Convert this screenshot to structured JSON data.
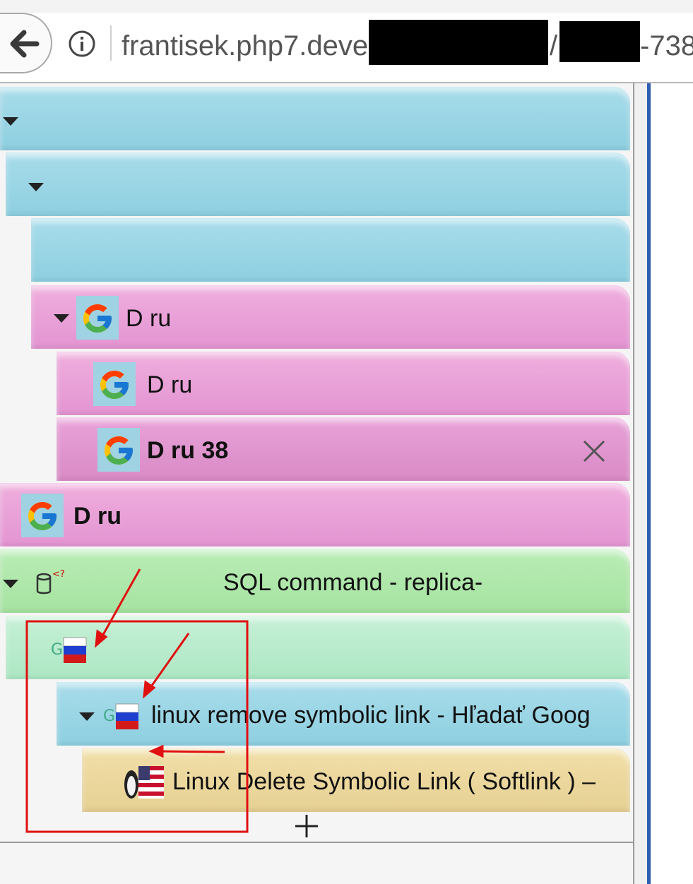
{
  "browser": {
    "url_visible_start": "frantisek.php7.deve",
    "url_visible_mid": "/",
    "url_visible_end": "-738"
  },
  "tabs": [
    {
      "label": "",
      "color": "blue",
      "has_twisty": true,
      "favicon": "none"
    },
    {
      "label": "",
      "color": "blue",
      "has_twisty": true,
      "favicon": "none"
    },
    {
      "label": "",
      "color": "blue",
      "has_twisty": false,
      "favicon": "none"
    },
    {
      "label": "D ru",
      "color": "pink",
      "has_twisty": true,
      "favicon": "google-icon"
    },
    {
      "label": "D ru",
      "color": "pink",
      "has_twisty": false,
      "favicon": "google-icon"
    },
    {
      "label": "D ru 38",
      "color": "pink",
      "has_twisty": false,
      "favicon": "google-icon",
      "selected": true,
      "close": true
    },
    {
      "label": "D ru",
      "color": "pink",
      "has_twisty": false,
      "favicon": "google-icon"
    },
    {
      "label": "SQL command - replica-",
      "color": "green",
      "has_twisty": true,
      "favicon": "database-icon"
    },
    {
      "label": "",
      "color": "mint",
      "has_twisty": false,
      "favicon": "google-russia-icon"
    },
    {
      "label": "linux remove symbolic link - Hľadať Goog",
      "color": "blue",
      "has_twisty": true,
      "favicon": "google-russia-icon"
    },
    {
      "label": "Linux Delete Symbolic Link ( Softlink ) – ",
      "color": "tan",
      "has_twisty": false,
      "favicon": "tux-usa-icon"
    }
  ],
  "colors": {
    "blue": "#9ad5e6",
    "pink": "#e69ad5",
    "green": "#a9e5a4",
    "mint": "#b4eac9",
    "tan": "#ead597",
    "annotation": "#e01010",
    "accent": "#2d5fb3"
  },
  "new_tab_symbol": "+"
}
